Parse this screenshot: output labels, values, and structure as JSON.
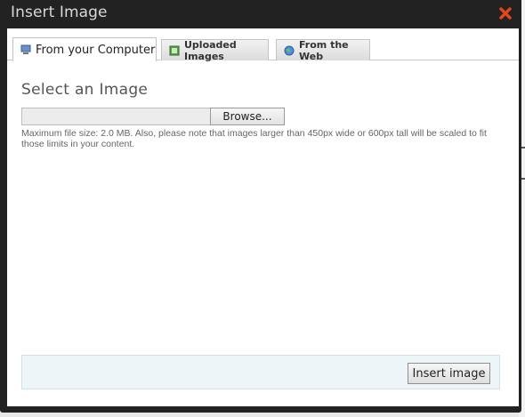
{
  "dialog": {
    "title": "Insert Image",
    "close_icon": "close-icon"
  },
  "tabs": [
    {
      "label": "From your Computer",
      "icon": "computer-icon",
      "active": true
    },
    {
      "label": "Uploaded Images",
      "icon": "image-icon",
      "active": false
    },
    {
      "label": "From the Web",
      "icon": "globe-icon",
      "active": false
    }
  ],
  "upload": {
    "heading": "Select an Image",
    "file_value": "",
    "browse_label": "Browse...",
    "hint": "Maximum file size: 2.0 MB. Also, please note that images larger than 450px wide or 600px tall will be scaled to fit those limits in your content."
  },
  "footer": {
    "insert_label": "Insert image"
  },
  "colors": {
    "frame": "#222222",
    "close": "#e0471d",
    "footer_bg": "#eef5f8"
  }
}
